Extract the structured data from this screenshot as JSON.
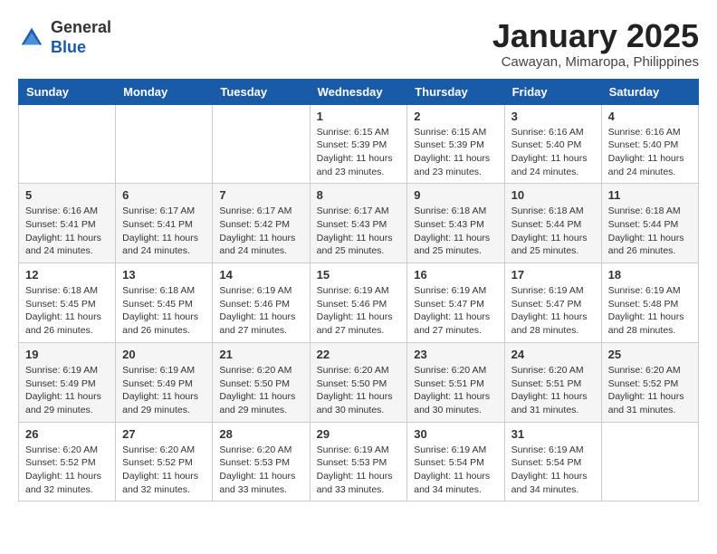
{
  "logo": {
    "general": "General",
    "blue": "Blue"
  },
  "title": "January 2025",
  "subtitle": "Cawayan, Mimaropa, Philippines",
  "days_of_week": [
    "Sunday",
    "Monday",
    "Tuesday",
    "Wednesday",
    "Thursday",
    "Friday",
    "Saturday"
  ],
  "weeks": [
    [
      null,
      null,
      null,
      {
        "day": "1",
        "sunrise": "6:15 AM",
        "sunset": "5:39 PM",
        "daylight": "11 hours and 23 minutes."
      },
      {
        "day": "2",
        "sunrise": "6:15 AM",
        "sunset": "5:39 PM",
        "daylight": "11 hours and 23 minutes."
      },
      {
        "day": "3",
        "sunrise": "6:16 AM",
        "sunset": "5:40 PM",
        "daylight": "11 hours and 24 minutes."
      },
      {
        "day": "4",
        "sunrise": "6:16 AM",
        "sunset": "5:40 PM",
        "daylight": "11 hours and 24 minutes."
      }
    ],
    [
      {
        "day": "5",
        "sunrise": "6:16 AM",
        "sunset": "5:41 PM",
        "daylight": "11 hours and 24 minutes."
      },
      {
        "day": "6",
        "sunrise": "6:17 AM",
        "sunset": "5:41 PM",
        "daylight": "11 hours and 24 minutes."
      },
      {
        "day": "7",
        "sunrise": "6:17 AM",
        "sunset": "5:42 PM",
        "daylight": "11 hours and 24 minutes."
      },
      {
        "day": "8",
        "sunrise": "6:17 AM",
        "sunset": "5:43 PM",
        "daylight": "11 hours and 25 minutes."
      },
      {
        "day": "9",
        "sunrise": "6:18 AM",
        "sunset": "5:43 PM",
        "daylight": "11 hours and 25 minutes."
      },
      {
        "day": "10",
        "sunrise": "6:18 AM",
        "sunset": "5:44 PM",
        "daylight": "11 hours and 25 minutes."
      },
      {
        "day": "11",
        "sunrise": "6:18 AM",
        "sunset": "5:44 PM",
        "daylight": "11 hours and 26 minutes."
      }
    ],
    [
      {
        "day": "12",
        "sunrise": "6:18 AM",
        "sunset": "5:45 PM",
        "daylight": "11 hours and 26 minutes."
      },
      {
        "day": "13",
        "sunrise": "6:18 AM",
        "sunset": "5:45 PM",
        "daylight": "11 hours and 26 minutes."
      },
      {
        "day": "14",
        "sunrise": "6:19 AM",
        "sunset": "5:46 PM",
        "daylight": "11 hours and 27 minutes."
      },
      {
        "day": "15",
        "sunrise": "6:19 AM",
        "sunset": "5:46 PM",
        "daylight": "11 hours and 27 minutes."
      },
      {
        "day": "16",
        "sunrise": "6:19 AM",
        "sunset": "5:47 PM",
        "daylight": "11 hours and 27 minutes."
      },
      {
        "day": "17",
        "sunrise": "6:19 AM",
        "sunset": "5:47 PM",
        "daylight": "11 hours and 28 minutes."
      },
      {
        "day": "18",
        "sunrise": "6:19 AM",
        "sunset": "5:48 PM",
        "daylight": "11 hours and 28 minutes."
      }
    ],
    [
      {
        "day": "19",
        "sunrise": "6:19 AM",
        "sunset": "5:49 PM",
        "daylight": "11 hours and 29 minutes."
      },
      {
        "day": "20",
        "sunrise": "6:19 AM",
        "sunset": "5:49 PM",
        "daylight": "11 hours and 29 minutes."
      },
      {
        "day": "21",
        "sunrise": "6:20 AM",
        "sunset": "5:50 PM",
        "daylight": "11 hours and 29 minutes."
      },
      {
        "day": "22",
        "sunrise": "6:20 AM",
        "sunset": "5:50 PM",
        "daylight": "11 hours and 30 minutes."
      },
      {
        "day": "23",
        "sunrise": "6:20 AM",
        "sunset": "5:51 PM",
        "daylight": "11 hours and 30 minutes."
      },
      {
        "day": "24",
        "sunrise": "6:20 AM",
        "sunset": "5:51 PM",
        "daylight": "11 hours and 31 minutes."
      },
      {
        "day": "25",
        "sunrise": "6:20 AM",
        "sunset": "5:52 PM",
        "daylight": "11 hours and 31 minutes."
      }
    ],
    [
      {
        "day": "26",
        "sunrise": "6:20 AM",
        "sunset": "5:52 PM",
        "daylight": "11 hours and 32 minutes."
      },
      {
        "day": "27",
        "sunrise": "6:20 AM",
        "sunset": "5:52 PM",
        "daylight": "11 hours and 32 minutes."
      },
      {
        "day": "28",
        "sunrise": "6:20 AM",
        "sunset": "5:53 PM",
        "daylight": "11 hours and 33 minutes."
      },
      {
        "day": "29",
        "sunrise": "6:19 AM",
        "sunset": "5:53 PM",
        "daylight": "11 hours and 33 minutes."
      },
      {
        "day": "30",
        "sunrise": "6:19 AM",
        "sunset": "5:54 PM",
        "daylight": "11 hours and 34 minutes."
      },
      {
        "day": "31",
        "sunrise": "6:19 AM",
        "sunset": "5:54 PM",
        "daylight": "11 hours and 34 minutes."
      },
      null
    ]
  ]
}
